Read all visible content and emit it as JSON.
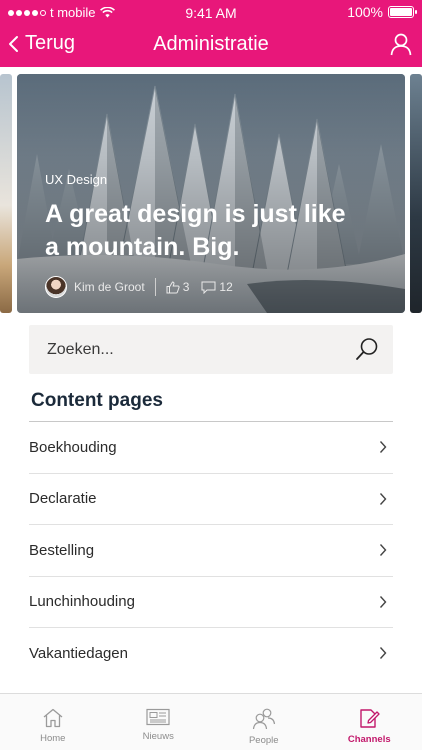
{
  "status": {
    "carrier": "t mobile",
    "time": "9:41 AM",
    "battery": "100%"
  },
  "nav": {
    "back_label": "Terug",
    "title": "Administratie"
  },
  "hero": {
    "category": "UX Design",
    "headline": "A great design is just like a mountain. Big.",
    "author": "Kim de Groot",
    "likes": "3",
    "comments": "12"
  },
  "search": {
    "placeholder": "Zoeken..."
  },
  "content": {
    "title": "Content pages",
    "items": [
      "Boekhouding",
      "Declaratie",
      "Bestelling",
      "Lunchinhouding",
      "Vakantiedagen"
    ]
  },
  "tabs": [
    {
      "label": "Home",
      "icon": "home-icon",
      "active": false
    },
    {
      "label": "Nieuws",
      "icon": "news-icon",
      "active": false
    },
    {
      "label": "People",
      "icon": "people-icon",
      "active": false
    },
    {
      "label": "Channels",
      "icon": "channels-icon",
      "active": true
    }
  ],
  "colors": {
    "brand": "#e8177a",
    "active_tab": "#c2186b"
  }
}
